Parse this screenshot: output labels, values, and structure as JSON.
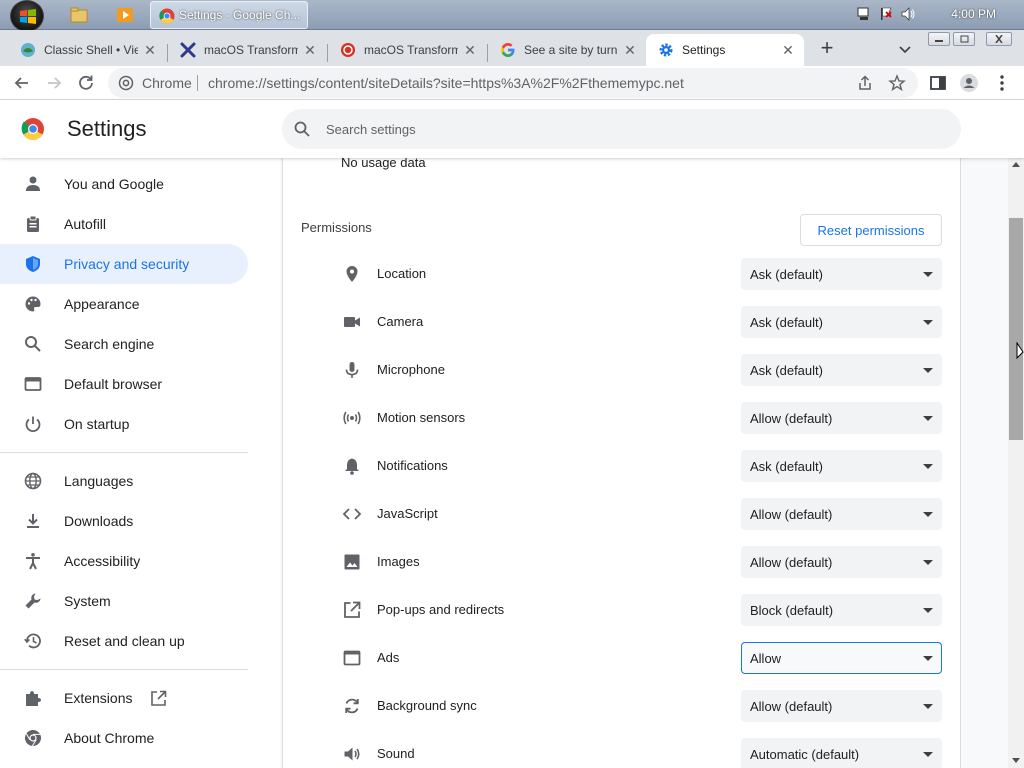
{
  "taskbar": {
    "chrome_window_title": "Settings - Google Ch...",
    "clock": "4:00 PM",
    "icons": [
      "start-orb",
      "file-explorer-icon",
      "media-player-icon",
      "chrome-icon",
      "network-icon",
      "flag-icon",
      "volume-icon"
    ]
  },
  "tabs": [
    {
      "title": "Classic Shell • View",
      "favicon": "classic-shell-icon",
      "active": false
    },
    {
      "title": "macOS Transformati",
      "favicon": "x-logo-icon",
      "active": false
    },
    {
      "title": "macOS Transformati",
      "favicon": "red-circle-icon",
      "active": false
    },
    {
      "title": "See a site by turnin",
      "favicon": "google-icon",
      "active": false
    },
    {
      "title": "Settings",
      "favicon": "settings-gear-icon",
      "active": true
    }
  ],
  "toolbar": {
    "site_chip": "Chrome",
    "url": "chrome://settings/content/siteDetails?site=https%3A%2F%2Fthememypc.net"
  },
  "header": {
    "title": "Settings",
    "search_placeholder": "Search settings"
  },
  "sidebar": {
    "items": [
      {
        "label": "You and Google",
        "icon": "person-icon",
        "active": false
      },
      {
        "label": "Autofill",
        "icon": "clipboard-icon",
        "active": false
      },
      {
        "label": "Privacy and security",
        "icon": "shield-icon",
        "active": true
      },
      {
        "label": "Appearance",
        "icon": "palette-icon",
        "active": false
      },
      {
        "label": "Search engine",
        "icon": "search-icon",
        "active": false
      },
      {
        "label": "Default browser",
        "icon": "browser-window-icon",
        "active": false
      },
      {
        "label": "On startup",
        "icon": "power-icon",
        "active": false
      },
      {
        "label": "Languages",
        "icon": "globe-icon",
        "active": false
      },
      {
        "label": "Downloads",
        "icon": "download-icon",
        "active": false
      },
      {
        "label": "Accessibility",
        "icon": "accessibility-icon",
        "active": false
      },
      {
        "label": "System",
        "icon": "wrench-icon",
        "active": false
      },
      {
        "label": "Reset and clean up",
        "icon": "history-icon",
        "active": false
      },
      {
        "label": "Extensions",
        "icon": "puzzle-icon",
        "active": false
      },
      {
        "label": "About Chrome",
        "icon": "chrome-icon",
        "active": false
      }
    ]
  },
  "content": {
    "usage_text": "No usage data",
    "permissions_heading": "Permissions",
    "reset_button": "Reset permissions",
    "permissions": [
      {
        "label": "Location",
        "value": "Ask (default)",
        "icon": "location-pin-icon"
      },
      {
        "label": "Camera",
        "value": "Ask (default)",
        "icon": "camera-icon"
      },
      {
        "label": "Microphone",
        "value": "Ask (default)",
        "icon": "microphone-icon"
      },
      {
        "label": "Motion sensors",
        "value": "Allow (default)",
        "icon": "sensors-icon"
      },
      {
        "label": "Notifications",
        "value": "Ask (default)",
        "icon": "bell-icon"
      },
      {
        "label": "JavaScript",
        "value": "Allow (default)",
        "icon": "code-icon"
      },
      {
        "label": "Images",
        "value": "Allow (default)",
        "icon": "image-icon"
      },
      {
        "label": "Pop-ups and redirects",
        "value": "Block (default)",
        "icon": "open-in-new-icon"
      },
      {
        "label": "Ads",
        "value": "Allow",
        "icon": "ads-window-icon",
        "focused": true
      },
      {
        "label": "Background sync",
        "value": "Allow (default)",
        "icon": "sync-icon"
      },
      {
        "label": "Sound",
        "value": "Automatic (default)",
        "icon": "speaker-icon"
      }
    ]
  },
  "colors": {
    "accent": "#1a73e8",
    "active_nav_bg": "#e8f0fe",
    "tabstrip_bg": "#dee1e6"
  }
}
